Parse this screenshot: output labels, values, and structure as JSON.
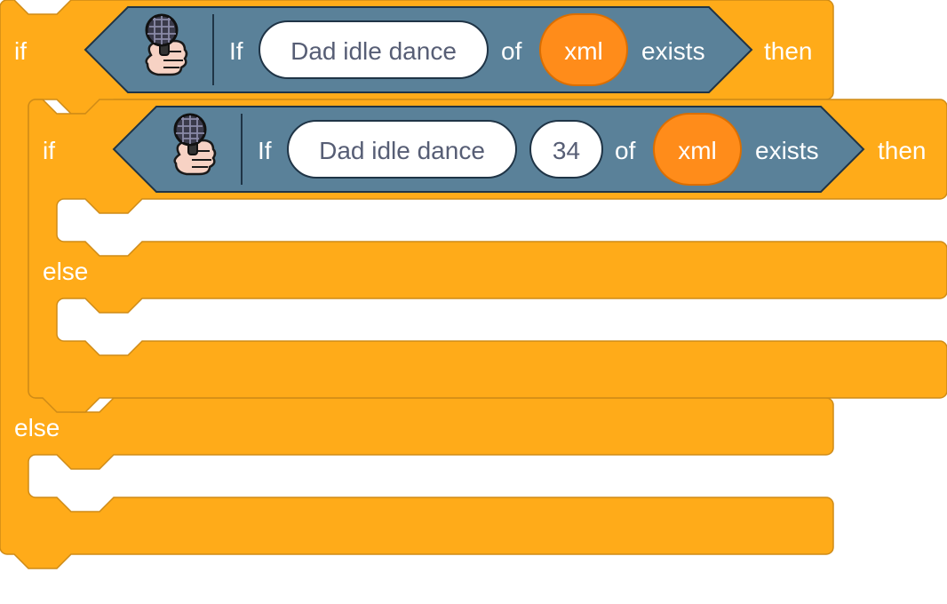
{
  "colors": {
    "control": "#ffab19",
    "control_border": "#cf8b17",
    "extension": "#5a8199",
    "extension_border": "#1f3446",
    "reporter": "#ff8c1a",
    "reporter_border": "#db6e00",
    "field_border": "#1f3446"
  },
  "outer_if": {
    "if_label": "if",
    "then_label": "then",
    "else_label": "else",
    "condition": {
      "icon": "microphone-hand-icon",
      "if_word": "If",
      "name_field": "Dad idle dance",
      "of_word": "of",
      "reporter": "xml",
      "exists_word": "exists"
    }
  },
  "inner_if": {
    "if_label": "if",
    "then_label": "then",
    "else_label": "else",
    "condition": {
      "icon": "microphone-hand-icon",
      "if_word": "If",
      "name_field": "Dad idle dance",
      "number_field": "34",
      "of_word": "of",
      "reporter": "xml",
      "exists_word": "exists"
    }
  }
}
